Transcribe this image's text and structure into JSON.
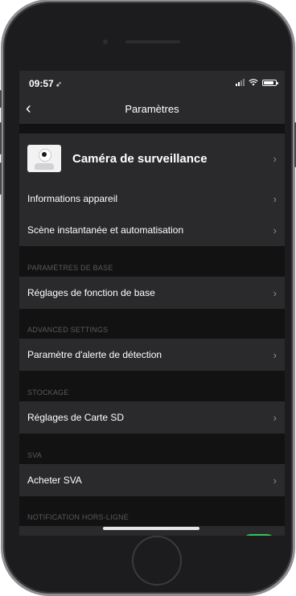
{
  "status_bar": {
    "time": "09:57",
    "location_glyph": "➶"
  },
  "nav": {
    "back_glyph": "‹",
    "title": "Paramètres"
  },
  "device": {
    "name": "Caméra de surveillance"
  },
  "rows": [
    {
      "label": "Informations appareil"
    },
    {
      "label": "Scène instantanée et automatisation"
    }
  ],
  "sections": {
    "basic": {
      "header": "PARAMÈTRES DE BASE",
      "row": "Réglages de fonction de base"
    },
    "advanced": {
      "header": "ADVANCED SETTINGS",
      "row": "Paramètre d'alerte de détection"
    },
    "storage": {
      "header": "STOCKAGE",
      "row": "Réglages de Carte SD"
    },
    "sva": {
      "header": "SVA",
      "row": "Acheter SVA"
    },
    "offline": {
      "header": "NOTIFICATION HORS-LIGNE"
    }
  },
  "chevron": "›",
  "colors": {
    "toggle_on": "#34c759",
    "row_bg": "#2a2a2c",
    "screen_bg": "#121212"
  }
}
